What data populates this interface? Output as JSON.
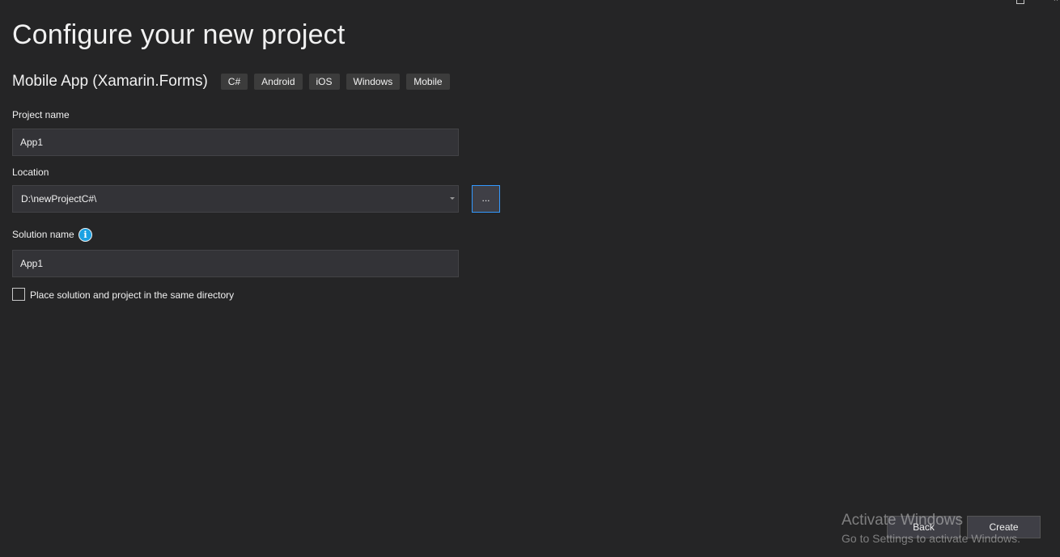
{
  "header": {
    "title": "Configure your new project"
  },
  "template": {
    "name": "Mobile App (Xamarin.Forms)",
    "tags": [
      "C#",
      "Android",
      "iOS",
      "Windows",
      "Mobile"
    ]
  },
  "form": {
    "project_name_label": "Project name",
    "project_name_value": "App1",
    "location_label": "Location",
    "location_value": "D:\\newProjectC#\\",
    "browse_label": "...",
    "solution_name_label": "Solution name",
    "solution_name_value": "App1",
    "info_glyph": "i",
    "same_directory_label": "Place solution and project in the same directory",
    "same_directory_checked": false
  },
  "footer": {
    "back_label": "Back",
    "create_label": "Create"
  },
  "watermark": {
    "line1": "Activate Windows",
    "line2": "Go to Settings to activate Windows."
  },
  "colors": {
    "background": "#252526",
    "field_background": "#333337",
    "focus_border": "#3399ff",
    "info_icon": "#1ba1e2"
  }
}
